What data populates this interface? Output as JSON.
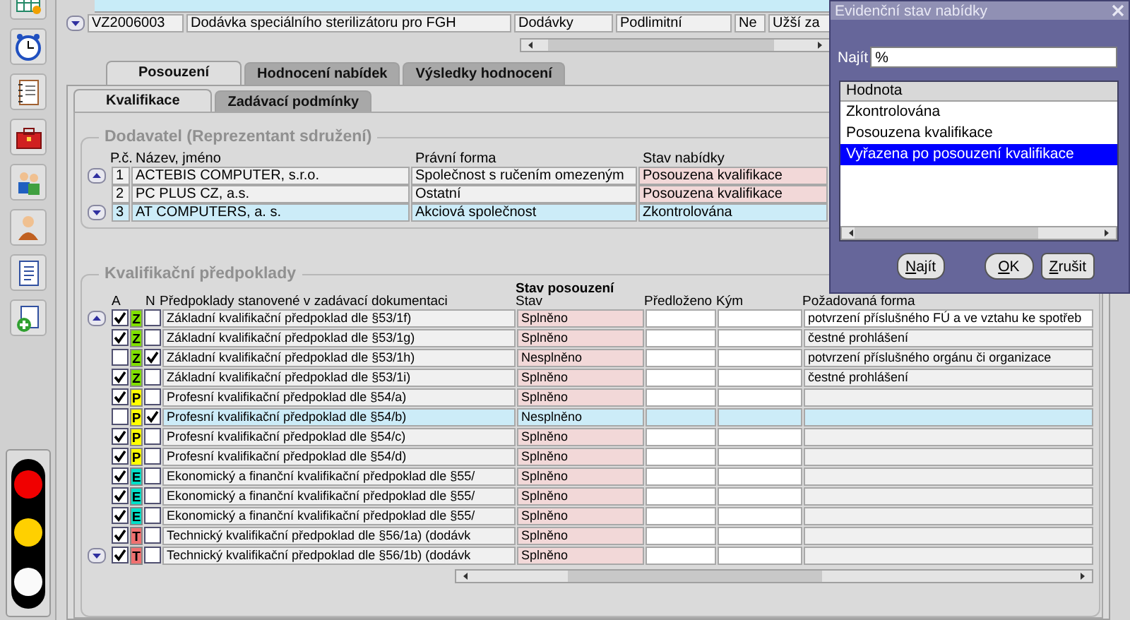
{
  "projects": {
    "rows": [
      {
        "code": "VZ2006003",
        "name": "Dodávka speciálního sterilizátoru pro FGH",
        "category": "Dodávky",
        "limit": "Podlimitní",
        "column_5": "Ne",
        "column_6": "Užší za"
      }
    ]
  },
  "tabs": [
    {
      "label": "Posouzení",
      "selected": true
    },
    {
      "label": "Hodnocení nabídek",
      "selected": false
    },
    {
      "label": "Výsledky hodnocení",
      "selected": false
    }
  ],
  "subtabs": [
    {
      "label": "Kvalifikace",
      "selected": true
    },
    {
      "label": "Zadávací podmínky",
      "selected": false
    }
  ],
  "suppliers": {
    "title": "Dodavatel (Reprezentant sdružení)",
    "columns": [
      "P.č.",
      "Název, jméno",
      "Právní forma",
      "Stav nabídky"
    ],
    "rows": [
      {
        "number": "1",
        "name": "ACTEBIS COMPUTER, s.r.o.",
        "legal_form": "Společnost s ručením omezeným",
        "status": "Posouzena kvalifikace",
        "selected": false
      },
      {
        "number": "2",
        "name": "PC PLUS CZ, a.s.",
        "legal_form": "Ostatní",
        "status": "Posouzena kvalifikace",
        "selected": false
      },
      {
        "number": "3",
        "name": "AT COMPUTERS, a. s.",
        "legal_form": "Akciová společnost",
        "status": "Zkontrolována",
        "selected": true
      }
    ]
  },
  "qualifications": {
    "title": "Kvalifikační předpoklady",
    "group_heading": "Stav posouzení",
    "columns": [
      "A",
      "N",
      "Předpoklady stanovené v zadávací dokumentaci",
      "Stav",
      "Předloženo",
      "Kým",
      "Požadovaná forma"
    ],
    "rows": [
      {
        "a": true,
        "category": "Z",
        "color": "#80e000",
        "n": false,
        "requirement": "Základní kvalifikační předpoklad dle §53/1f)",
        "status": "Splněno",
        "form": "potvrzení příslušného FÚ a ve vztahu ke spotřeb",
        "selected": false
      },
      {
        "a": true,
        "category": "Z",
        "color": "#80e000",
        "n": false,
        "requirement": "Základní kvalifikační předpoklad dle §53/1g)",
        "status": "Splněno",
        "form": "čestné prohlášení",
        "selected": false
      },
      {
        "a": false,
        "category": "Z",
        "color": "#80e000",
        "n": true,
        "requirement": "Základní kvalifikační předpoklad dle §53/1h)",
        "status": "Nesplněno",
        "form": "potvrzení příslušného orgánu či organizace",
        "selected": false
      },
      {
        "a": true,
        "category": "Z",
        "color": "#80e000",
        "n": false,
        "requirement": "Základní kvalifikační předpoklad dle §53/1i)",
        "status": "Splněno",
        "form": "čestné prohlášení",
        "selected": false
      },
      {
        "a": true,
        "category": "P",
        "color": "#ffff00",
        "n": false,
        "requirement": "Profesní kvalifikační předpoklad dle §54/a)",
        "status": "Splněno",
        "selected": false
      },
      {
        "a": false,
        "category": "P",
        "color": "#ffff00",
        "n": true,
        "requirement": "Profesní kvalifikační předpoklad dle §54/b)",
        "status": "Nesplněno",
        "selected": true
      },
      {
        "a": true,
        "category": "P",
        "color": "#ffff00",
        "n": false,
        "requirement": "Profesní kvalifikační předpoklad dle §54/c)",
        "status": "Splněno",
        "selected": false
      },
      {
        "a": true,
        "category": "P",
        "color": "#ffff00",
        "n": false,
        "requirement": "Profesní kvalifikační předpoklad dle §54/d)",
        "status": "Splněno",
        "selected": false
      },
      {
        "a": true,
        "category": "E",
        "color": "#00e0c8",
        "n": false,
        "requirement": "Ekonomický a finanční kvalifikační předpoklad dle §55/",
        "status": "Splněno",
        "selected": false
      },
      {
        "a": true,
        "category": "E",
        "color": "#00e0c8",
        "n": false,
        "requirement": "Ekonomický a finanční kvalifikační předpoklad dle §55/",
        "status": "Splněno",
        "selected": false
      },
      {
        "a": true,
        "category": "E",
        "color": "#00e0c8",
        "n": false,
        "requirement": "Ekonomický a finanční kvalifikační předpoklad dle §55/",
        "status": "Splněno",
        "selected": false
      },
      {
        "a": true,
        "category": "T",
        "color": "#f07070",
        "n": false,
        "requirement": "Technický kvalifikační předpoklad dle §56/1a) (dodávk",
        "status": "Splněno",
        "selected": false
      },
      {
        "a": true,
        "category": "T",
        "color": "#f07070",
        "n": false,
        "requirement": "Technický kvalifikační předpoklad dle §56/1b) (dodávk",
        "status": "Splněno",
        "selected": false
      }
    ]
  },
  "dialog": {
    "title": "Evidenční stav nabídky",
    "search_label": "Najít",
    "search_value": "%",
    "list_header": "Hodnota",
    "items": [
      {
        "label": "Zkontrolována",
        "selected": false
      },
      {
        "label": "Posouzena kvalifikace",
        "selected": false
      },
      {
        "label": "Vyřazena po posouzení kvalifikace",
        "selected": true
      }
    ],
    "buttons": [
      {
        "label": "Najít",
        "kind": "find"
      },
      {
        "label": "OK",
        "kind": "ok"
      },
      {
        "label": "Zrušit",
        "kind": "cancel"
      }
    ]
  }
}
